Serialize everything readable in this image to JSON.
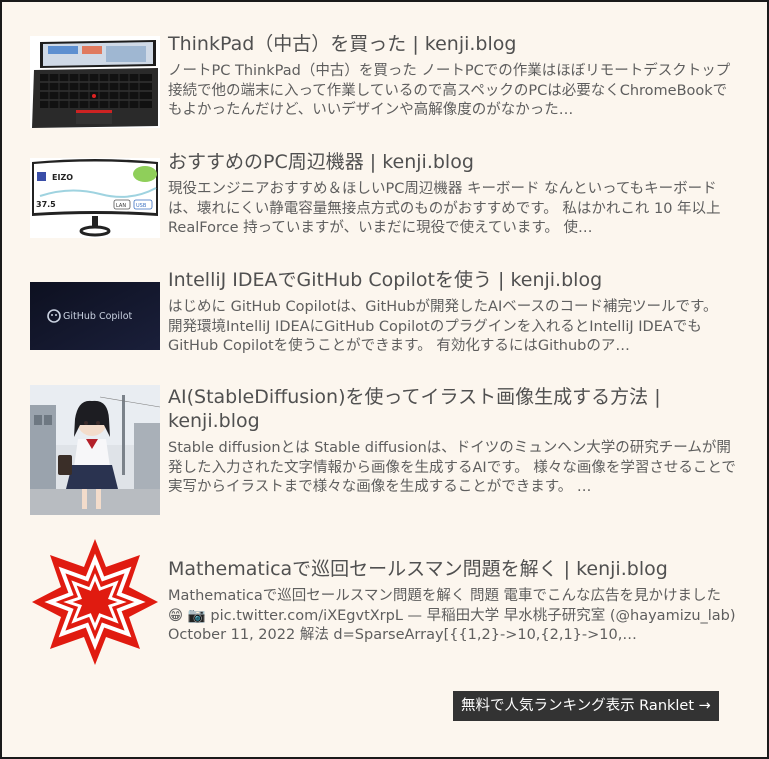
{
  "items": [
    {
      "title": "ThinkPad（中古）を買った | kenji.blog",
      "description": "ノートPC ThinkPad（中古）を買った ノートPCでの作業はほぼリモートデスクトップ接続で他の端末に入って作業しているので高スペックのPCは必要なくChromeBookでもよかったんだけど、いいデザインや高解像度のがなかった…",
      "thumbnail": "laptop-image"
    },
    {
      "title": "おすすめのPC周辺機器 | kenji.blog",
      "description": "現役エンジニアおすすめ＆ほしいPC周辺機器 キーボード なんといってもキーボードは、壊れにくい静電容量無接点方式のものがおすすめです。 私はかれこれ 10 年以上 RealForce 持っていますが、いまだに現役で使えています。 使…",
      "thumbnail": "monitor-image",
      "thumb_text": {
        "brand": "EIZO",
        "size": "37.5",
        "lan": "LAN",
        "usb": "USB"
      }
    },
    {
      "title": "IntelliJ IDEAでGitHub Copilotを使う | kenji.blog",
      "description": "はじめに GitHub Copilotは、GitHubが開発したAIベースのコード補完ツールです。 開発環境IntelliJ IDEAにGitHub Copilotのプラグインを入れるとIntelliJ IDEAでもGitHub Copilotを使うことができます。 有効化するにはGithubのア…",
      "thumbnail": "github-copilot-image",
      "thumb_text": {
        "label": "GitHub Copilot"
      }
    },
    {
      "title": "AI(StableDiffusion)を使ってイラスト画像生成する方法 | kenji.blog",
      "description": "Stable diffusionとは Stable diffusionは、ドイツのミュンヘン大学の研究チームが開発した入力された文字情報から画像を生成するAIです。 様々な画像を学習させることで実写からイラストまで様々な画像を生成することができます。 …",
      "thumbnail": "anime-illustration-image"
    },
    {
      "title": "Mathematicaで巡回セールスマン問題を解く | kenji.blog",
      "description": "Mathematicaで巡回セールスマン問題を解く 問題 電車でこんな広告を見かけました 😁 📷 pic.twitter.com/iXEgvtXrpL — 早稲田大学 早水桃子研究室 (@hayamizu_lab) October 11, 2022 解法 d=SparseArray[{{1,2}->10,{2,1}->10,…",
      "thumbnail": "mathematica-logo"
    }
  ],
  "ranklet": {
    "label": "無料で人気ランキング表示 Ranklet →"
  },
  "colors": {
    "background": "#fcf6ee",
    "title": "#505050",
    "text": "#5e5e5e",
    "button": "#333333",
    "mathematica_red": "#e01b10"
  }
}
